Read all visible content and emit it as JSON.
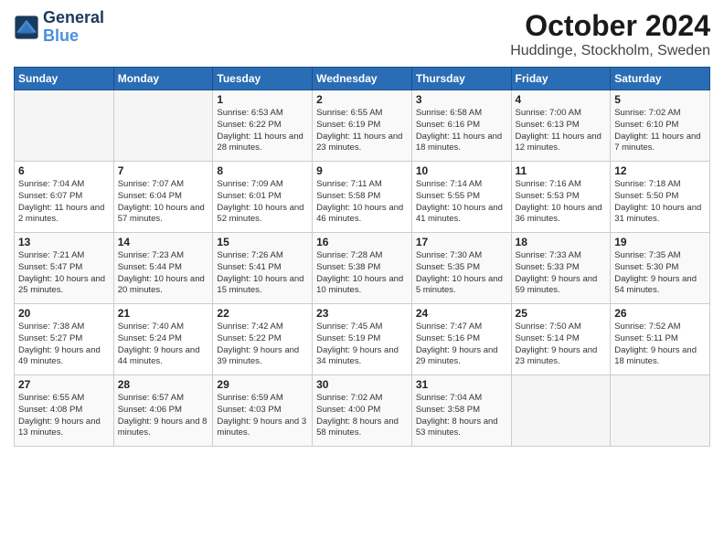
{
  "logo": {
    "line1": "General",
    "line2": "Blue"
  },
  "title": "October 2024",
  "subtitle": "Huddinge, Stockholm, Sweden",
  "header_days": [
    "Sunday",
    "Monday",
    "Tuesday",
    "Wednesday",
    "Thursday",
    "Friday",
    "Saturday"
  ],
  "weeks": [
    [
      {
        "day": "",
        "sunrise": "",
        "sunset": "",
        "daylight": ""
      },
      {
        "day": "",
        "sunrise": "",
        "sunset": "",
        "daylight": ""
      },
      {
        "day": "1",
        "sunrise": "Sunrise: 6:53 AM",
        "sunset": "Sunset: 6:22 PM",
        "daylight": "Daylight: 11 hours and 28 minutes."
      },
      {
        "day": "2",
        "sunrise": "Sunrise: 6:55 AM",
        "sunset": "Sunset: 6:19 PM",
        "daylight": "Daylight: 11 hours and 23 minutes."
      },
      {
        "day": "3",
        "sunrise": "Sunrise: 6:58 AM",
        "sunset": "Sunset: 6:16 PM",
        "daylight": "Daylight: 11 hours and 18 minutes."
      },
      {
        "day": "4",
        "sunrise": "Sunrise: 7:00 AM",
        "sunset": "Sunset: 6:13 PM",
        "daylight": "Daylight: 11 hours and 12 minutes."
      },
      {
        "day": "5",
        "sunrise": "Sunrise: 7:02 AM",
        "sunset": "Sunset: 6:10 PM",
        "daylight": "Daylight: 11 hours and 7 minutes."
      }
    ],
    [
      {
        "day": "6",
        "sunrise": "Sunrise: 7:04 AM",
        "sunset": "Sunset: 6:07 PM",
        "daylight": "Daylight: 11 hours and 2 minutes."
      },
      {
        "day": "7",
        "sunrise": "Sunrise: 7:07 AM",
        "sunset": "Sunset: 6:04 PM",
        "daylight": "Daylight: 10 hours and 57 minutes."
      },
      {
        "day": "8",
        "sunrise": "Sunrise: 7:09 AM",
        "sunset": "Sunset: 6:01 PM",
        "daylight": "Daylight: 10 hours and 52 minutes."
      },
      {
        "day": "9",
        "sunrise": "Sunrise: 7:11 AM",
        "sunset": "Sunset: 5:58 PM",
        "daylight": "Daylight: 10 hours and 46 minutes."
      },
      {
        "day": "10",
        "sunrise": "Sunrise: 7:14 AM",
        "sunset": "Sunset: 5:55 PM",
        "daylight": "Daylight: 10 hours and 41 minutes."
      },
      {
        "day": "11",
        "sunrise": "Sunrise: 7:16 AM",
        "sunset": "Sunset: 5:53 PM",
        "daylight": "Daylight: 10 hours and 36 minutes."
      },
      {
        "day": "12",
        "sunrise": "Sunrise: 7:18 AM",
        "sunset": "Sunset: 5:50 PM",
        "daylight": "Daylight: 10 hours and 31 minutes."
      }
    ],
    [
      {
        "day": "13",
        "sunrise": "Sunrise: 7:21 AM",
        "sunset": "Sunset: 5:47 PM",
        "daylight": "Daylight: 10 hours and 25 minutes."
      },
      {
        "day": "14",
        "sunrise": "Sunrise: 7:23 AM",
        "sunset": "Sunset: 5:44 PM",
        "daylight": "Daylight: 10 hours and 20 minutes."
      },
      {
        "day": "15",
        "sunrise": "Sunrise: 7:26 AM",
        "sunset": "Sunset: 5:41 PM",
        "daylight": "Daylight: 10 hours and 15 minutes."
      },
      {
        "day": "16",
        "sunrise": "Sunrise: 7:28 AM",
        "sunset": "Sunset: 5:38 PM",
        "daylight": "Daylight: 10 hours and 10 minutes."
      },
      {
        "day": "17",
        "sunrise": "Sunrise: 7:30 AM",
        "sunset": "Sunset: 5:35 PM",
        "daylight": "Daylight: 10 hours and 5 minutes."
      },
      {
        "day": "18",
        "sunrise": "Sunrise: 7:33 AM",
        "sunset": "Sunset: 5:33 PM",
        "daylight": "Daylight: 9 hours and 59 minutes."
      },
      {
        "day": "19",
        "sunrise": "Sunrise: 7:35 AM",
        "sunset": "Sunset: 5:30 PM",
        "daylight": "Daylight: 9 hours and 54 minutes."
      }
    ],
    [
      {
        "day": "20",
        "sunrise": "Sunrise: 7:38 AM",
        "sunset": "Sunset: 5:27 PM",
        "daylight": "Daylight: 9 hours and 49 minutes."
      },
      {
        "day": "21",
        "sunrise": "Sunrise: 7:40 AM",
        "sunset": "Sunset: 5:24 PM",
        "daylight": "Daylight: 9 hours and 44 minutes."
      },
      {
        "day": "22",
        "sunrise": "Sunrise: 7:42 AM",
        "sunset": "Sunset: 5:22 PM",
        "daylight": "Daylight: 9 hours and 39 minutes."
      },
      {
        "day": "23",
        "sunrise": "Sunrise: 7:45 AM",
        "sunset": "Sunset: 5:19 PM",
        "daylight": "Daylight: 9 hours and 34 minutes."
      },
      {
        "day": "24",
        "sunrise": "Sunrise: 7:47 AM",
        "sunset": "Sunset: 5:16 PM",
        "daylight": "Daylight: 9 hours and 29 minutes."
      },
      {
        "day": "25",
        "sunrise": "Sunrise: 7:50 AM",
        "sunset": "Sunset: 5:14 PM",
        "daylight": "Daylight: 9 hours and 23 minutes."
      },
      {
        "day": "26",
        "sunrise": "Sunrise: 7:52 AM",
        "sunset": "Sunset: 5:11 PM",
        "daylight": "Daylight: 9 hours and 18 minutes."
      }
    ],
    [
      {
        "day": "27",
        "sunrise": "Sunrise: 6:55 AM",
        "sunset": "Sunset: 4:08 PM",
        "daylight": "Daylight: 9 hours and 13 minutes."
      },
      {
        "day": "28",
        "sunrise": "Sunrise: 6:57 AM",
        "sunset": "Sunset: 4:06 PM",
        "daylight": "Daylight: 9 hours and 8 minutes."
      },
      {
        "day": "29",
        "sunrise": "Sunrise: 6:59 AM",
        "sunset": "Sunset: 4:03 PM",
        "daylight": "Daylight: 9 hours and 3 minutes."
      },
      {
        "day": "30",
        "sunrise": "Sunrise: 7:02 AM",
        "sunset": "Sunset: 4:00 PM",
        "daylight": "Daylight: 8 hours and 58 minutes."
      },
      {
        "day": "31",
        "sunrise": "Sunrise: 7:04 AM",
        "sunset": "Sunset: 3:58 PM",
        "daylight": "Daylight: 8 hours and 53 minutes."
      },
      {
        "day": "",
        "sunrise": "",
        "sunset": "",
        "daylight": ""
      },
      {
        "day": "",
        "sunrise": "",
        "sunset": "",
        "daylight": ""
      }
    ]
  ]
}
